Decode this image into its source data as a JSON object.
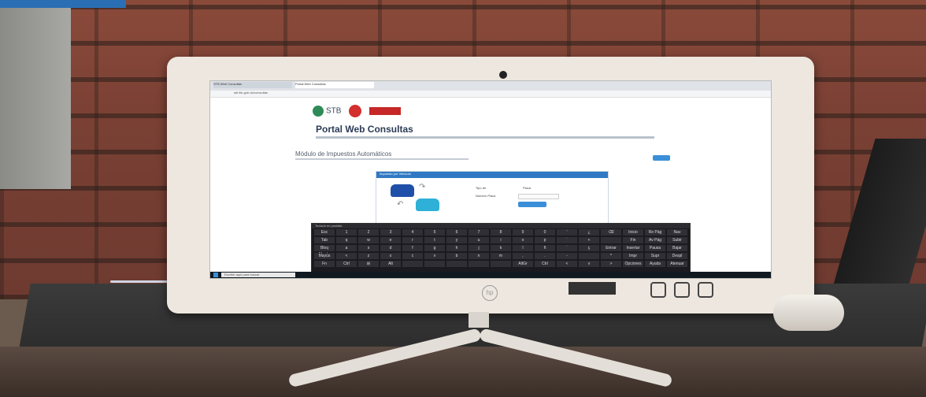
{
  "browser": {
    "tabs": [
      "STB Web Consultas",
      "Portal Web Consultas"
    ],
    "address": "stb.ittc.gob.do/consultas"
  },
  "page": {
    "logo_stb": "STB",
    "title": "Portal Web Consultas",
    "module_title": "Módulo de Impuestos Automáticos",
    "panel_title": "Impuesto por Vehículo",
    "labels": {
      "type": "Tipo de",
      "plate": "Placa",
      "plate_number": "Número Placa"
    },
    "query_button": "Consultar"
  },
  "keyboard": {
    "title": "Teclado en pantalla",
    "rows": [
      [
        "Esc",
        "1",
        "2",
        "3",
        "4",
        "5",
        "6",
        "7",
        "8",
        "9",
        "0",
        "'",
        "¿",
        "⌫",
        "Inicio",
        "Re Pág",
        "Nav"
      ],
      [
        "Tab",
        "q",
        "w",
        "e",
        "r",
        "t",
        "y",
        "u",
        "i",
        "o",
        "p",
        "`",
        "+",
        "",
        "Fin",
        "Av Pág",
        "Subir"
      ],
      [
        "Bloq Mayús",
        "a",
        "s",
        "d",
        "f",
        "g",
        "h",
        "j",
        "k",
        "l",
        "ñ",
        "´",
        "ç",
        "Entrar",
        "Insertar",
        "Pausa",
        "Bajar"
      ],
      [
        "Mayús",
        "<",
        "z",
        "x",
        "c",
        "v",
        "b",
        "n",
        "m",
        ",",
        ".",
        "-",
        "",
        "^",
        "Impr",
        "Supr",
        "Despl"
      ],
      [
        "Fn",
        "Ctrl",
        "⊞",
        "Alt",
        "",
        "",
        "",
        "",
        "",
        "AltGr",
        "Ctrl",
        "<",
        "v",
        ">",
        "Opciones",
        "Ayuda",
        "Atenuar"
      ]
    ]
  },
  "taskbar": {
    "search_placeholder": "Escribe aquí para buscar"
  },
  "device": {
    "brand": "hp"
  }
}
